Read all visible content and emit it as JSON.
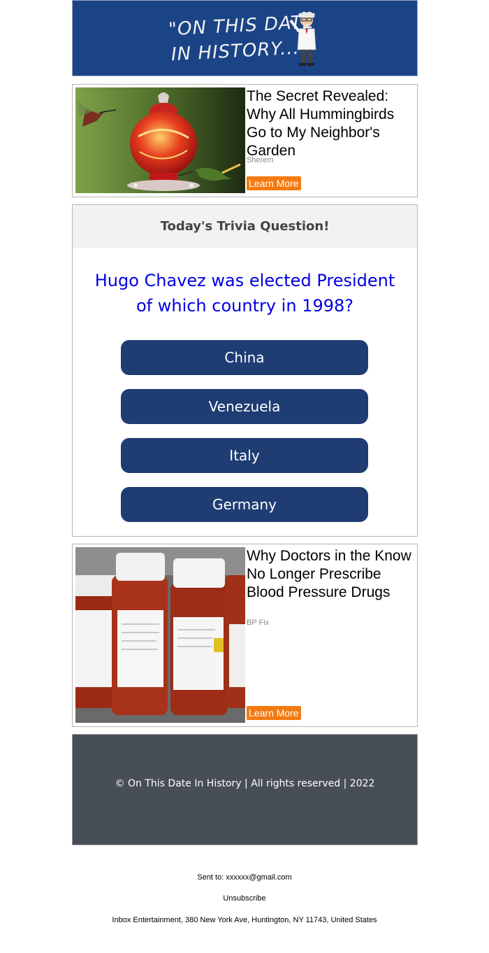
{
  "header": {
    "logo_line1": "\"ON THIS DATE",
    "logo_line2": "IN HISTORY...\"",
    "mascot_icon": "professor-icon"
  },
  "ad1": {
    "title": "The Secret Revealed: Why All Hummingbirds Go to My Neighbor's Garden",
    "source": "Sherem",
    "button": "Learn More",
    "image": "hummingbird-feeder-image"
  },
  "trivia": {
    "heading": "Today's Trivia Question!",
    "question": "Hugo Chavez was elected President of which country in 1998?",
    "answers": [
      "China",
      "Venezuela",
      "Italy",
      "Germany"
    ]
  },
  "ad2": {
    "title": "Why Doctors in the Know No Longer Prescribe Blood Pressure Drugs",
    "source": "BP Fix",
    "button": "Learn More",
    "image": "pill-bottles-image"
  },
  "footer": {
    "copyright": "© On This Date In History | All rights reserved | 2022"
  },
  "meta": {
    "sent_to": "Sent to: xxxxxx@gmail.com",
    "unsubscribe": "Unsubscribe",
    "address": "Inbox Entertainment, 380 New York Ave, Huntington, NY 11743, United States"
  },
  "colors": {
    "header_bg": "#1b4487",
    "answer_bg": "#1f3c73",
    "question": "#0000e0",
    "learn_more": "#f47a12",
    "footer_bg": "#474e58"
  }
}
